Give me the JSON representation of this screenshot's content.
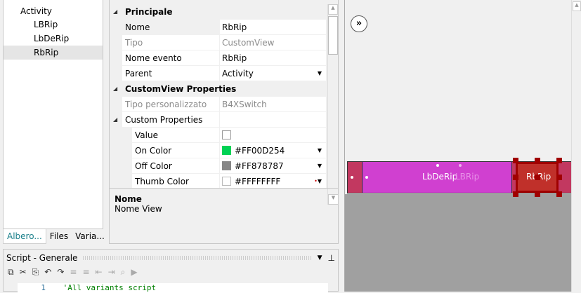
{
  "tree": {
    "items": [
      "Activity",
      "LBRip",
      "LbDeRip",
      "RbRip"
    ],
    "selected": "RbRip"
  },
  "tabs": [
    "Albero...",
    "Files",
    "Varia..."
  ],
  "props": {
    "cat1": "Principale",
    "rows1": [
      {
        "label": "Nome",
        "value": "RbRip"
      },
      {
        "label": "Tipo",
        "value": "CustomView"
      },
      {
        "label": "Nome evento",
        "value": "RbRip"
      },
      {
        "label": "Parent",
        "value": "Activity"
      }
    ],
    "cat2": "CustomView Properties",
    "tipo_label": "Tipo personalizzato",
    "tipo_value": "B4XSwitch",
    "cat3": "Custom Properties",
    "value_label": "Value",
    "colors": [
      {
        "label": "On Color",
        "value": "#FF00D254",
        "swatch": "#00d254"
      },
      {
        "label": "Off Color",
        "value": "#FF878787",
        "swatch": "#878787"
      },
      {
        "label": "Thumb Color",
        "value": "#FFFFFFFF",
        "swatch": "#ffffff"
      }
    ],
    "desc_title": "Nome",
    "desc_text": "Nome View"
  },
  "script": {
    "title": "Script - Generale",
    "line_no": "1",
    "code": "'All variants script"
  },
  "designer": {
    "labels": [
      "LbDeRip",
      "LBRip",
      "RbRip"
    ]
  }
}
